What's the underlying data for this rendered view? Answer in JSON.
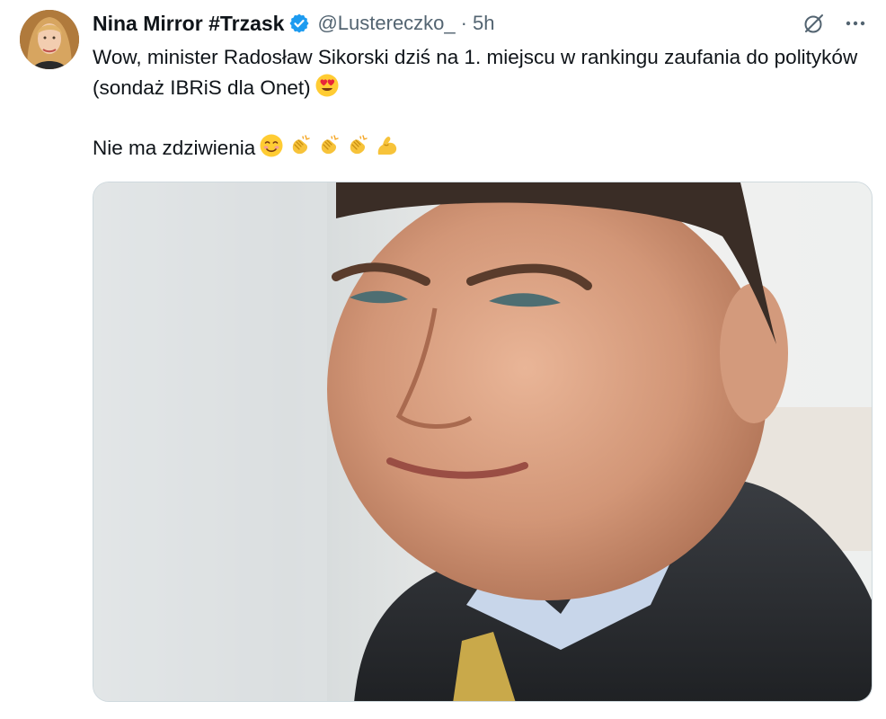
{
  "author": {
    "name": "Nina Mirror #Trzask",
    "handle": "@Lustereczko_",
    "separator": "·",
    "time": "5h",
    "verified": true,
    "verified_color": "#1d9bf0"
  },
  "actions": {
    "grok_icon": "grok-icon",
    "more_icon": "more-icon"
  },
  "tweet": {
    "line1": "Wow, minister Radosław Sikorski dziś na 1. miejscu w rankingu zaufania do polityków (sondaż IBRiS dla Onet)",
    "line1_emoji": "😍",
    "line2": "Nie ma zdziwienia",
    "line2_emojis": [
      "😊",
      "👏",
      "👏",
      "👏",
      "💪"
    ]
  },
  "media": {
    "type": "photo",
    "subject": "portrait-photo"
  },
  "colors": {
    "text": "#0f1419",
    "secondary": "#536471",
    "accent": "#1d9bf0"
  }
}
